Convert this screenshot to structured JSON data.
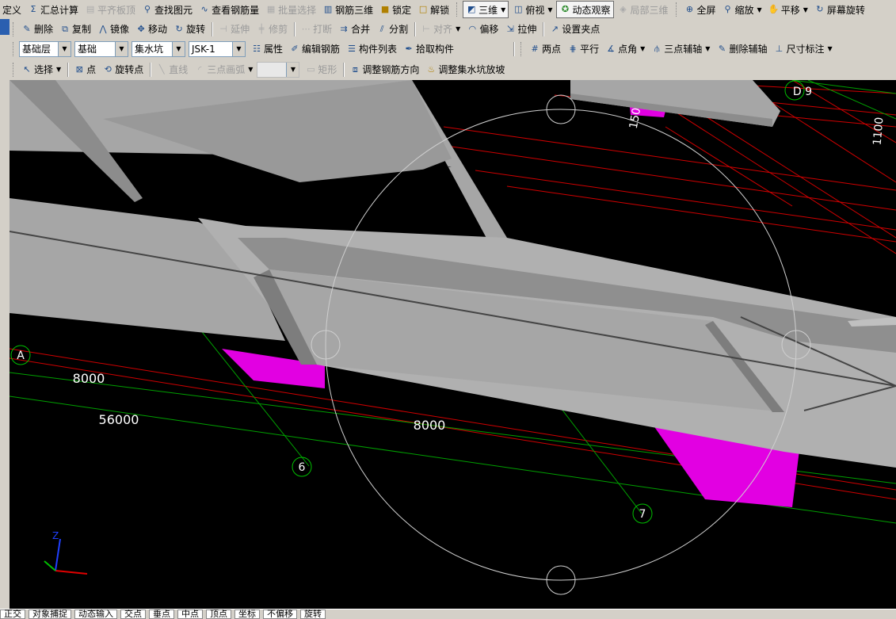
{
  "menubar": {
    "items": [
      "定义",
      "汇总计算",
      "平齐板顶",
      "查找图元",
      "查看钢筋量",
      "批量选择",
      "钢筋三维",
      "锁定",
      "解锁",
      "三维",
      "俯视",
      "动态观察",
      "局部三维",
      "全屏",
      "缩放",
      "平移",
      "屏幕旋转"
    ]
  },
  "edit_toolbar": {
    "items": [
      "删除",
      "复制",
      "镜像",
      "移动",
      "旋转",
      "延伸",
      "修剪",
      "打断",
      "合并",
      "分割",
      "对齐",
      "偏移",
      "拉伸",
      "设置夹点"
    ]
  },
  "selector_toolbar": {
    "floor": "基础层",
    "category": "基础",
    "type": "集水坑",
    "component": "JSK-1",
    "items": [
      "属性",
      "编辑钢筋",
      "构件列表",
      "拾取构件"
    ],
    "aux_items": [
      "两点",
      "平行",
      "点角",
      "三点辅轴",
      "删除辅轴",
      "尺寸标注"
    ]
  },
  "draw_toolbar": {
    "items": [
      "选择",
      "点",
      "旋转点",
      "直线",
      "三点画弧",
      "矩形",
      "调整钢筋方向",
      "调整集水坑放坡"
    ]
  },
  "viewport": {
    "axis_labels": {
      "a": "A",
      "d9": "D 9",
      "six": "6",
      "seven": "7"
    },
    "dims": {
      "d8000a": "8000",
      "d56000": "56000",
      "d8000b": "8000",
      "d150": "150",
      "d1100": "1100"
    },
    "gizmo": {
      "z": "Z"
    },
    "colors": {
      "background": "#000000",
      "slab": "#a6a6a6",
      "pit": "#e200e2",
      "axis_red": "#e00000",
      "axis_green": "#00b000"
    }
  },
  "statusbar": {
    "items": [
      "正交",
      "对象捕捉",
      "动态输入",
      "交点",
      "垂点",
      "中点",
      "顶点",
      "坐标",
      "不偏移",
      "旋转"
    ]
  }
}
